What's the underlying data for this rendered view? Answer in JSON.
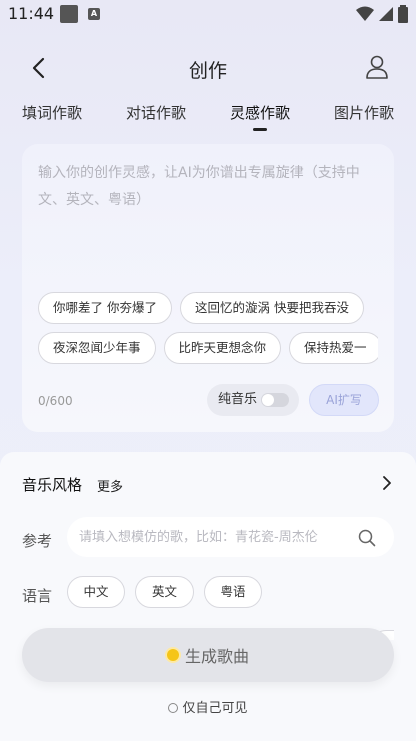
{
  "status": {
    "time": "11:44"
  },
  "header": {
    "title": "创作"
  },
  "tabs": [
    {
      "label": "填词作歌",
      "active": false
    },
    {
      "label": "对话作歌",
      "active": false
    },
    {
      "label": "灵感作歌",
      "active": true
    },
    {
      "label": "图片作歌",
      "active": false
    }
  ],
  "inspiration": {
    "placeholder": "输入你的创作灵感，让AI为你谱出专属旋律（支持中文、英文、粤语）",
    "chips_row1": [
      "你哪差了 你夯爆了",
      "这回忆的漩涡 快要把我吞没"
    ],
    "chips_row2": [
      "夜深忽闻少年事",
      "比昨天更想念你",
      "保持热爱一"
    ],
    "counter": "0/600",
    "pure_music_label": "纯音乐",
    "pure_music_on": false,
    "ai_expand_label": "AI扩写"
  },
  "style": {
    "title": "音乐风格",
    "more": "更多"
  },
  "reference": {
    "label": "参考",
    "placeholder": "请填入想模仿的歌，比如：青花瓷-周杰伦"
  },
  "language": {
    "label": "语言",
    "options": [
      "中文",
      "英文",
      "粤语"
    ]
  },
  "generate": {
    "label": "生成歌曲"
  },
  "privacy": {
    "label": "仅自己可见",
    "checked": false
  }
}
